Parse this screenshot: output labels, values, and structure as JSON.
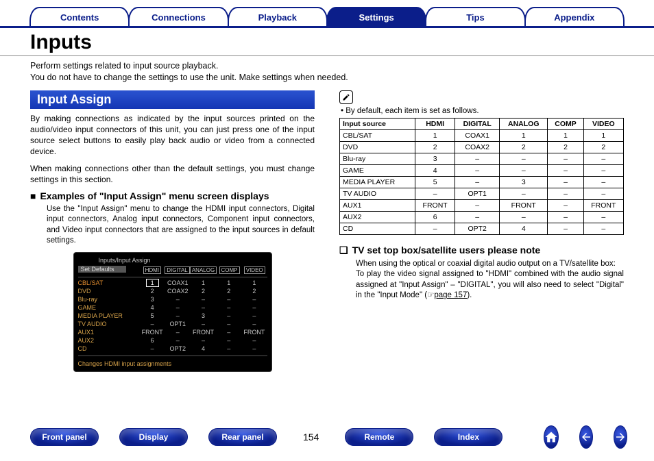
{
  "tabs": [
    "Contents",
    "Connections",
    "Playback",
    "Settings",
    "Tips",
    "Appendix"
  ],
  "active_tab_index": 3,
  "title": "Inputs",
  "intro1": "Perform settings related to input source playback.",
  "intro2": "You do not have to change the settings to use the unit. Make settings when needed.",
  "section_bar": "Input Assign",
  "left_para1": "By making connections as indicated by the input sources printed on the audio/video input connectors of this unit, you can just press one of the input source select buttons to easily play back audio or video from a connected device.",
  "left_para2": "When making connections other than the default settings, you must change settings in this section.",
  "subhead1_mark": "■",
  "subhead1": "Examples of \"Input Assign\" menu screen displays",
  "subpara1": "Use the \"Input Assign\" menu to change the HDMI input connectors, Digital input connectors, Analog input connectors, Component input connectors, and Video input connectors that are assigned to the input sources in default settings.",
  "menu": {
    "breadcrumb": "Inputs/Input Assign",
    "defaults_label": "Set Defaults",
    "headers": [
      "HDMI",
      "DIGITAL",
      "ANALOG",
      "COMP",
      "VIDEO"
    ],
    "rows": [
      {
        "src": "CBL/SAT",
        "v": [
          "1",
          "COAX1",
          "1",
          "1",
          "1"
        ],
        "first": true
      },
      {
        "src": "DVD",
        "v": [
          "2",
          "COAX2",
          "2",
          "2",
          "2"
        ]
      },
      {
        "src": "Blu-ray",
        "v": [
          "3",
          "–",
          "–",
          "–",
          "–"
        ]
      },
      {
        "src": "GAME",
        "v": [
          "4",
          "–",
          "–",
          "–",
          "–"
        ]
      },
      {
        "src": "MEDIA PLAYER",
        "v": [
          "5",
          "–",
          "3",
          "–",
          "–"
        ]
      },
      {
        "src": "TV AUDIO",
        "v": [
          "–",
          "OPT1",
          "–",
          "–",
          "–"
        ]
      },
      {
        "src": "AUX1",
        "v": [
          "FRONT",
          "–",
          "FRONT",
          "–",
          "FRONT"
        ]
      },
      {
        "src": "AUX2",
        "v": [
          "6",
          "–",
          "–",
          "–",
          "–"
        ]
      },
      {
        "src": "CD",
        "v": [
          "–",
          "OPT2",
          "4",
          "–",
          "–"
        ]
      }
    ],
    "footer": "Changes HDMI input assignments"
  },
  "default_note": "• By default, each item is set as follows.",
  "table": {
    "headers": [
      "Input source",
      "HDMI",
      "DIGITAL",
      "ANALOG",
      "COMP",
      "VIDEO"
    ],
    "rows": [
      [
        "CBL/SAT",
        "1",
        "COAX1",
        "1",
        "1",
        "1"
      ],
      [
        "DVD",
        "2",
        "COAX2",
        "2",
        "2",
        "2"
      ],
      [
        "Blu-ray",
        "3",
        "–",
        "–",
        "–",
        "–"
      ],
      [
        "GAME",
        "4",
        "–",
        "–",
        "–",
        "–"
      ],
      [
        "MEDIA PLAYER",
        "5",
        "–",
        "3",
        "–",
        "–"
      ],
      [
        "TV AUDIO",
        "–",
        "OPT1",
        "–",
        "–",
        "–"
      ],
      [
        "AUX1",
        "FRONT",
        "–",
        "FRONT",
        "–",
        "FRONT"
      ],
      [
        "AUX2",
        "6",
        "–",
        "–",
        "–",
        "–"
      ],
      [
        "CD",
        "–",
        "OPT2",
        "4",
        "–",
        "–"
      ]
    ]
  },
  "subhead2_mark": "❏",
  "subhead2": "TV set top box/satellite users please note",
  "subpara2a": "When using the optical or coaxial digital audio output on a TV/satellite box:",
  "subpara2b_pre": "To play the video signal assigned to \"HDMI\" combined with the audio signal assigned at \"Input Assign\" – \"DIGITAL\", you will also need to select \"Digital\" in the \"Input Mode\" (",
  "subpara2b_link_icon": "☞",
  "subpara2b_link": "page 157",
  "subpara2b_post": ").",
  "footer_buttons": [
    "Front panel",
    "Display",
    "Rear panel"
  ],
  "footer_buttons2": [
    "Remote",
    "Index"
  ],
  "page_number": "154"
}
